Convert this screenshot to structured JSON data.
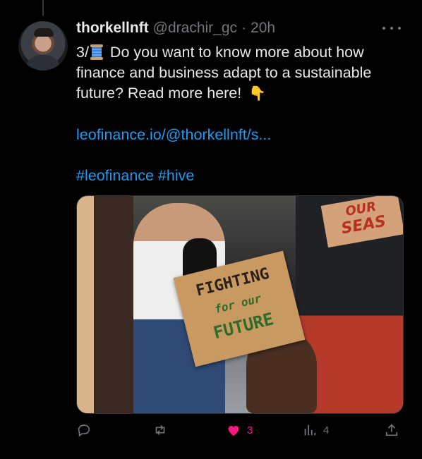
{
  "tweet": {
    "author_name": "thorkellnft",
    "handle": "@drachir_gc",
    "separator": "·",
    "time": "20h",
    "text": {
      "prefix": "3/",
      "emoji_thread": "🧵",
      "body": "Do you want to know more about how finance and business adapt to a sustainable future? Read more here!",
      "emoji_point": "👇",
      "link": "leofinance.io/@thorkellnft/s...",
      "hashtags": "#leofinance #hive"
    },
    "media": {
      "sign_main_line1": "FIGHTING",
      "sign_main_line2": "for our",
      "sign_main_line3": "FUTURE",
      "sign_top_line1": "OUR",
      "sign_top_line2": "SEAS"
    },
    "actions": {
      "reply_icon": "reply-icon",
      "repost_icon": "repost-icon",
      "like_icon": "heart-icon",
      "like_count": "3",
      "views_icon": "views-icon",
      "views_count": "4",
      "share_icon": "share-icon"
    }
  },
  "colors": {
    "background": "#000000",
    "text": "#e7e9ea",
    "secondary": "#71767b",
    "link": "#1d9bf0",
    "like": "#f91880"
  }
}
